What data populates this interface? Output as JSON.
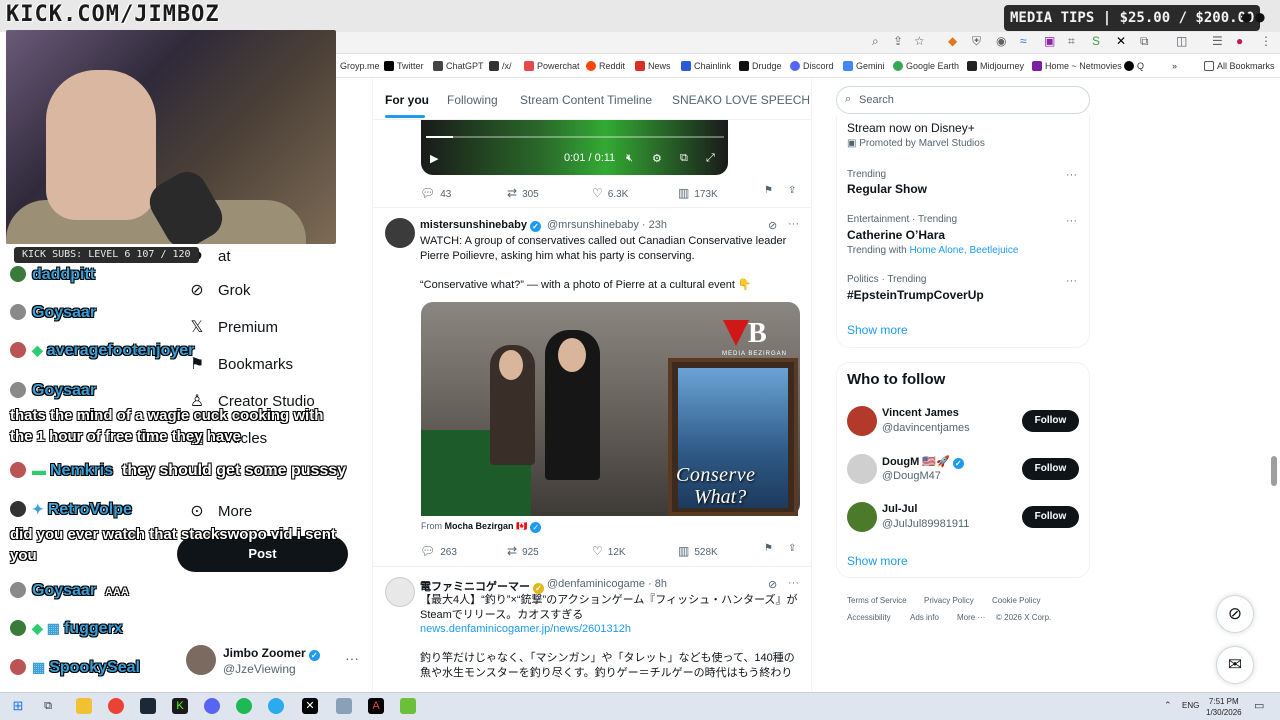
{
  "overlay": {
    "kick_url": "KICK.COM/JIMBOZ",
    "media_tips": "MEDIA TIPS | $25.00 / $200.00",
    "kick_subs": "KICK SUBS: LEVEL 6 107 / 120"
  },
  "chat": [
    {
      "user": "daddpitt",
      "msg": ""
    },
    {
      "user": "Goysaar",
      "msg": ""
    },
    {
      "user": "averagefootenjoyer",
      "msg": ""
    },
    {
      "user": "Goysaar",
      "msg": "thats the mind of a wagie cuck cooking with the 1 hour of free time they have"
    },
    {
      "user": "Nemkris",
      "msg": "they should get some pusssy"
    },
    {
      "user": "RetroVolpe",
      "msg": "did you ever watch that stackswopo vid i sent you"
    },
    {
      "user": "Goysaar",
      "msg": "AAA"
    },
    {
      "user": "fuggerx",
      "msg": ""
    },
    {
      "user": "SpookySeal",
      "msg": ""
    }
  ],
  "browser": {
    "bookmarks": [
      {
        "label": "Groyp.me",
        "color": "#888888"
      },
      {
        "label": "Twitter",
        "color": "#000000"
      },
      {
        "label": "ChatGPT",
        "color": "#444444"
      },
      {
        "label": "/x/",
        "color": "#333333"
      },
      {
        "label": "Powerchat",
        "color": "#e5484d"
      },
      {
        "label": "Reddit",
        "color": "#ff4500"
      },
      {
        "label": "News",
        "color": "#d93025"
      },
      {
        "label": "Chainlink",
        "color": "#2a5ada"
      },
      {
        "label": "Drudge",
        "color": "#111111"
      },
      {
        "label": "Discord",
        "color": "#5865f2"
      },
      {
        "label": "Gemini",
        "color": "#4285f4"
      },
      {
        "label": "Google Earth",
        "color": "#34a853"
      },
      {
        "label": "Midjourney",
        "color": "#222222"
      },
      {
        "label": "Home ~ Netmovies",
        "color": "#7b1fa2"
      },
      {
        "label": "Q",
        "color": "#000000"
      }
    ],
    "all_bookmarks": "All Bookmarks"
  },
  "nav": {
    "partial_chat": "at",
    "items": [
      "Grok",
      "Premium",
      "Bookmarks",
      "Creator Studio",
      "Articles",
      "More"
    ],
    "post_label": "Post",
    "account_name": "Jimbo Zoomer",
    "account_handle": "@JzeViewing"
  },
  "tabs": [
    "For you",
    "Following",
    "Stream Content Timeline",
    "SNEAKO LOVE SPEECH"
  ],
  "video": {
    "time": "0:01 / 0:11",
    "progress_fraction": 0.09
  },
  "tweet0": {
    "replies": "43",
    "reposts": "305",
    "likes": "6.3K",
    "views": "173K"
  },
  "tweet1": {
    "name": "mistersunshinebaby",
    "handle": "@mrsunshinebaby · 23h",
    "text": "WATCH: A group of conservatives called out Canadian Conservative leader Pierre Poilievre, asking him what his party is conserving.",
    "text2": "“Conservative what?” — with a photo of Pierre at a cultural event 👇",
    "image_logo_b": "B",
    "image_logo_sub": "MEDIA BEZIRGAN",
    "image_caption": "Conserve",
    "image_caption2": "What?",
    "from_prefix": "From",
    "from_name": "Mocha Bezirgan 🇨🇦",
    "replies": "263",
    "reposts": "925",
    "likes": "12K",
    "views": "528K"
  },
  "tweet2": {
    "name": "電ファミニコゲーマー",
    "handle": "@denfaminicogame · 8h",
    "text": "【最大4人】“釣り”×“銃撃”のアクションゲーム『フィッシュ・ハンターズ』がSteamでリリース。カオスすぎる",
    "link": "news.denfaminicogamer.jp/news/2601312h",
    "text2": "釣り竿だけじゃなく、「マシンガン」や「タレット」なども使って、140種の魚や水生モンスターを釣り尽くす。釣りゲー＝チルゲーの時代はもう終わり"
  },
  "sidebar": {
    "search_placeholder": "Search",
    "promo_title": "Stream now on Disney+",
    "promo_meta": "Promoted by Marvel Studios",
    "trends": [
      {
        "meta": "Trending",
        "title": "Regular Show",
        "extra_prefix": "",
        "extra_links": ""
      },
      {
        "meta": "Entertainment · Trending",
        "title": "Catherine O’Hara",
        "extra_prefix": "Trending with",
        "extra_links": "Home Alone, Beetlejuice"
      },
      {
        "meta": "Politics · Trending",
        "title": "#EpsteinTrumpCoverUp",
        "extra_prefix": "",
        "extra_links": ""
      }
    ],
    "show_more": "Show more",
    "who_to_follow": "Who to follow",
    "follow": [
      {
        "name": "Vincent James",
        "handle": "@davincentjames",
        "button": "Follow",
        "avatar_color": "#b33a2a"
      },
      {
        "name": "DougM 🇺🇸🚀",
        "handle": "@DougM47",
        "button": "Follow",
        "avatar_color": "#cfcfcf"
      },
      {
        "name": "Jul-Jul",
        "handle": "@JulJul89981911",
        "button": "Follow",
        "avatar_color": "#4a7a2a"
      }
    ],
    "footer": [
      "Terms of Service",
      "Privacy Policy",
      "Cookie Policy",
      "Accessibility",
      "Ads info",
      "More ···",
      "© 2026 X Corp."
    ]
  },
  "taskbar": {
    "lang": "ENG",
    "time": "7:51 PM",
    "date": "1/30/2026"
  }
}
